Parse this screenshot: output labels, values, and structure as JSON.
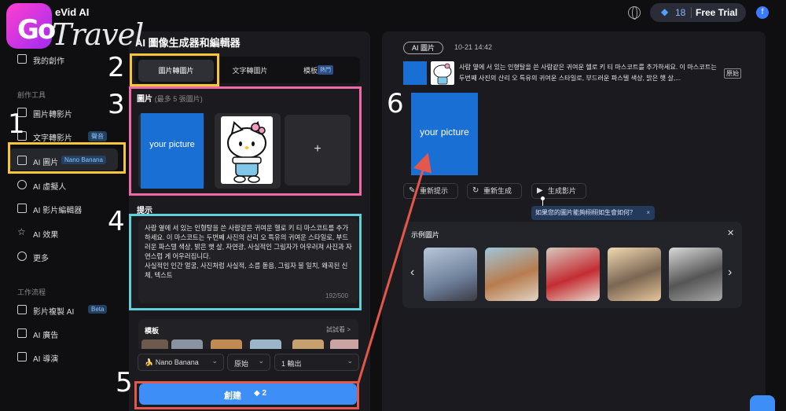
{
  "app": {
    "name": "eVid AI",
    "overlay_logo_prefix": "Go",
    "overlay_logo_text": "Travel"
  },
  "topbar": {
    "credits": "18",
    "trial_label": "Free Trial",
    "user_initial": "f"
  },
  "sidebar": {
    "my_creations": "我的創作",
    "section_tools": "創作工具",
    "items": [
      {
        "label": "圖片轉影片"
      },
      {
        "label": "文字轉影片",
        "badge": "聲音"
      },
      {
        "label": "AI 圖片",
        "badge": "Nano Banana"
      },
      {
        "label": "AI 虛擬人"
      },
      {
        "label": "AI 影片編輯器"
      },
      {
        "label": "AI 效果"
      },
      {
        "label": "更多"
      }
    ],
    "section_workflow": "工作流程",
    "workflow": [
      {
        "label": "影片複製 AI",
        "badge": "Beta"
      },
      {
        "label": "AI 廣告"
      },
      {
        "label": "AI 導演"
      }
    ]
  },
  "annotations": [
    "1",
    "2",
    "3",
    "4",
    "5",
    "6"
  ],
  "editor": {
    "title": "AI 圖像生成器和編輯器",
    "tabs": [
      {
        "label": "圖片轉圖片"
      },
      {
        "label": "文字轉圖片"
      },
      {
        "label": "模板",
        "badge": "熱門"
      }
    ],
    "images_label": "圖片",
    "images_hint": "(最多 5 張圖片)",
    "your_picture": "your picture",
    "add_symbol": "+",
    "prompt_label": "提示",
    "prompt_text": "사람 옆에 서 있는 인형탈을 쓴 사람같은 귀여운 헬로 키 티 마스코트를 추가하세요. 이 마스코트는 두번째 사진의 산리 오 특유의 귀여운 스타일로, 부드러운 파스텔 색상, 밝은 햇 살, 자연광, 사실적인 그림자가 어우러져 사진과 자연스럽 게 어우러집니다.\n사실적인 인간 얼굴, 사진처럼 사실적, 소름 돋음, 그림자 불 일치, 왜곡된 신체, 텍스트",
    "prompt_count": "192/500",
    "template_label": "模板",
    "template_more": "試試看 >",
    "model_select": "🍌 Nano Banana",
    "ratio_select": "原始",
    "output_select": "1 輸出",
    "create_label": "創建",
    "create_cost": "2"
  },
  "result": {
    "tag": "AI 圖片",
    "time": "10-21 14:42",
    "prompt_text": "사람 옆에 서 있는 인형탈을 쓴 사람같은 귀여운 헬로 키 티 마스코트를 추가하세요. 이 마스코트는 두번째 사진의 산리 오 특유의 귀여운 스타일로, 부드러운 파스텔 색상, 밝은 햇 살,...",
    "original_badge": "原始",
    "your_picture": "your picture",
    "buttons": [
      "重新提示",
      "重新生成",
      "生成影片"
    ],
    "tooltip": "如果您的圖片能夠栩栩如生會如何？",
    "examples_title": "示例圖片"
  }
}
